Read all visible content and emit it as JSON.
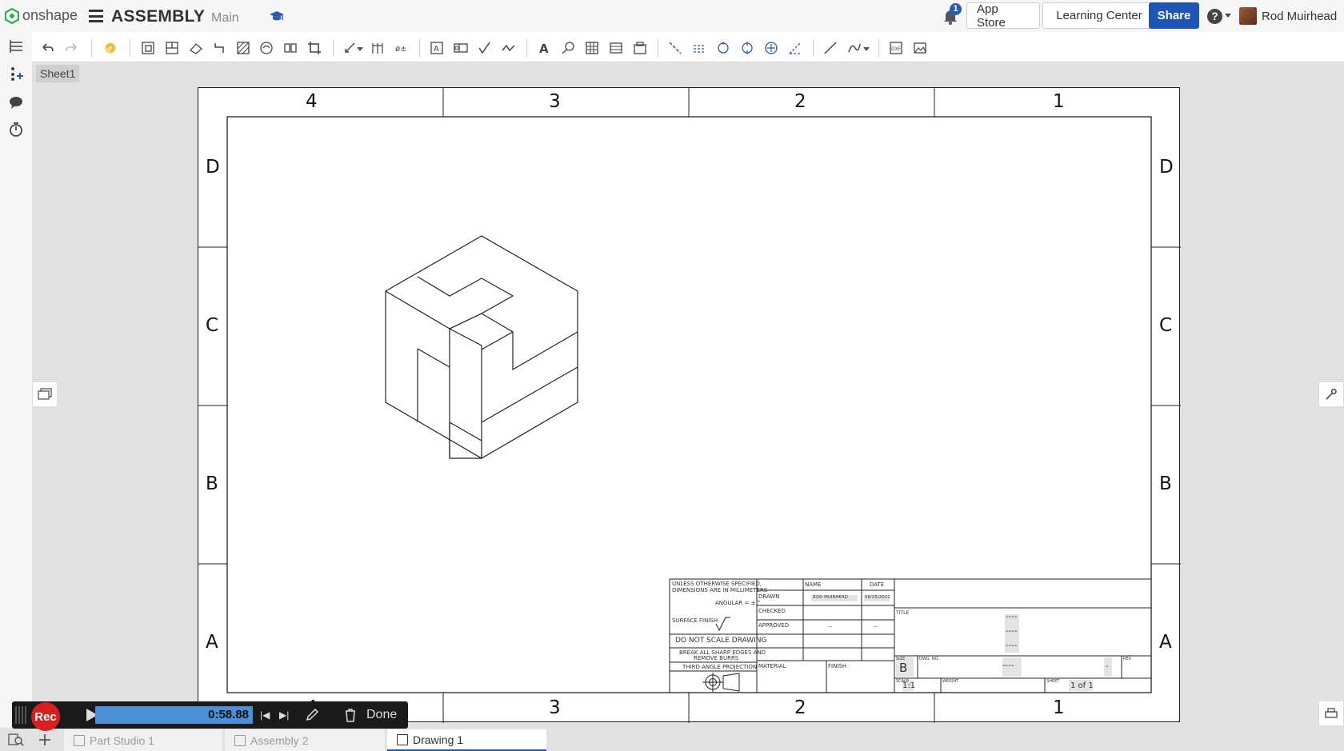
{
  "brand": {
    "name": "onshape"
  },
  "document": {
    "title": "ASSEMBLY",
    "branch": "Main"
  },
  "notifications": {
    "count": "1"
  },
  "header": {
    "app_store": "App Store",
    "learning_center": "Learning Center",
    "share": "Share",
    "help": "?",
    "user_name": "Rod Muirhead"
  },
  "sheet": {
    "tab_label": "Sheet1"
  },
  "drawing": {
    "zones_top": [
      "4",
      "3",
      "2",
      "1"
    ],
    "zones_bottom": [
      "4",
      "3",
      "2",
      "1"
    ],
    "zones_side": [
      "D",
      "C",
      "B",
      "A"
    ],
    "title_block": {
      "tolerance_note_1": "UNLESS OTHERWISE SPECIFIED,",
      "tolerance_note_2": "DIMENSIONS ARE IN MILLIMETERS",
      "angular": "ANGULAR = ± °",
      "surface_finish": "SURFACE FINISH",
      "do_not_scale": "DO NOT SCALE DRAWING",
      "break_edges_1": "BREAK ALL SHARP EDGES AND",
      "break_edges_2": "REMOVE BURRS",
      "projection": "THIRD ANGLE PROJECTION",
      "name_header": "NAME",
      "date_header": "DATE",
      "drawn_label": "DRAWN",
      "drawn_name": "ROD MUIRHEAD",
      "drawn_date": "08/25/2021",
      "checked_label": "CHECKED",
      "approved_label": "APPROVED",
      "approved_name": "--",
      "approved_date": "--",
      "material_label": "MATERIAL",
      "finish_label": "FINISH",
      "title_label": "TITLE",
      "title_value_1": "----",
      "title_value_2": "----",
      "title_value_3": "----",
      "size_label": "SIZE",
      "size_value": "B",
      "dwg_no_label": "DWG. NO.",
      "dwg_no_value": "----",
      "rev_label": "REV",
      "rev_value": "-",
      "scale_label": "SCALE",
      "scale_value": "1:1",
      "weight_label": "WEIGHT",
      "sheet_label": "SHEET",
      "sheet_value": "1 of 1"
    }
  },
  "recorder": {
    "rec_label": "Rec",
    "time": "0:58.88",
    "done_label": "Done",
    "progress": 1.0
  },
  "tabs": [
    {
      "label": "Part Studio 1",
      "active": false
    },
    {
      "label": "Assembly 2",
      "active": false
    },
    {
      "label": "Drawing 1",
      "active": true
    }
  ],
  "colors": {
    "accent": "#1d55b5",
    "record": "#d61f1f",
    "progress": "#4b8fd6"
  }
}
